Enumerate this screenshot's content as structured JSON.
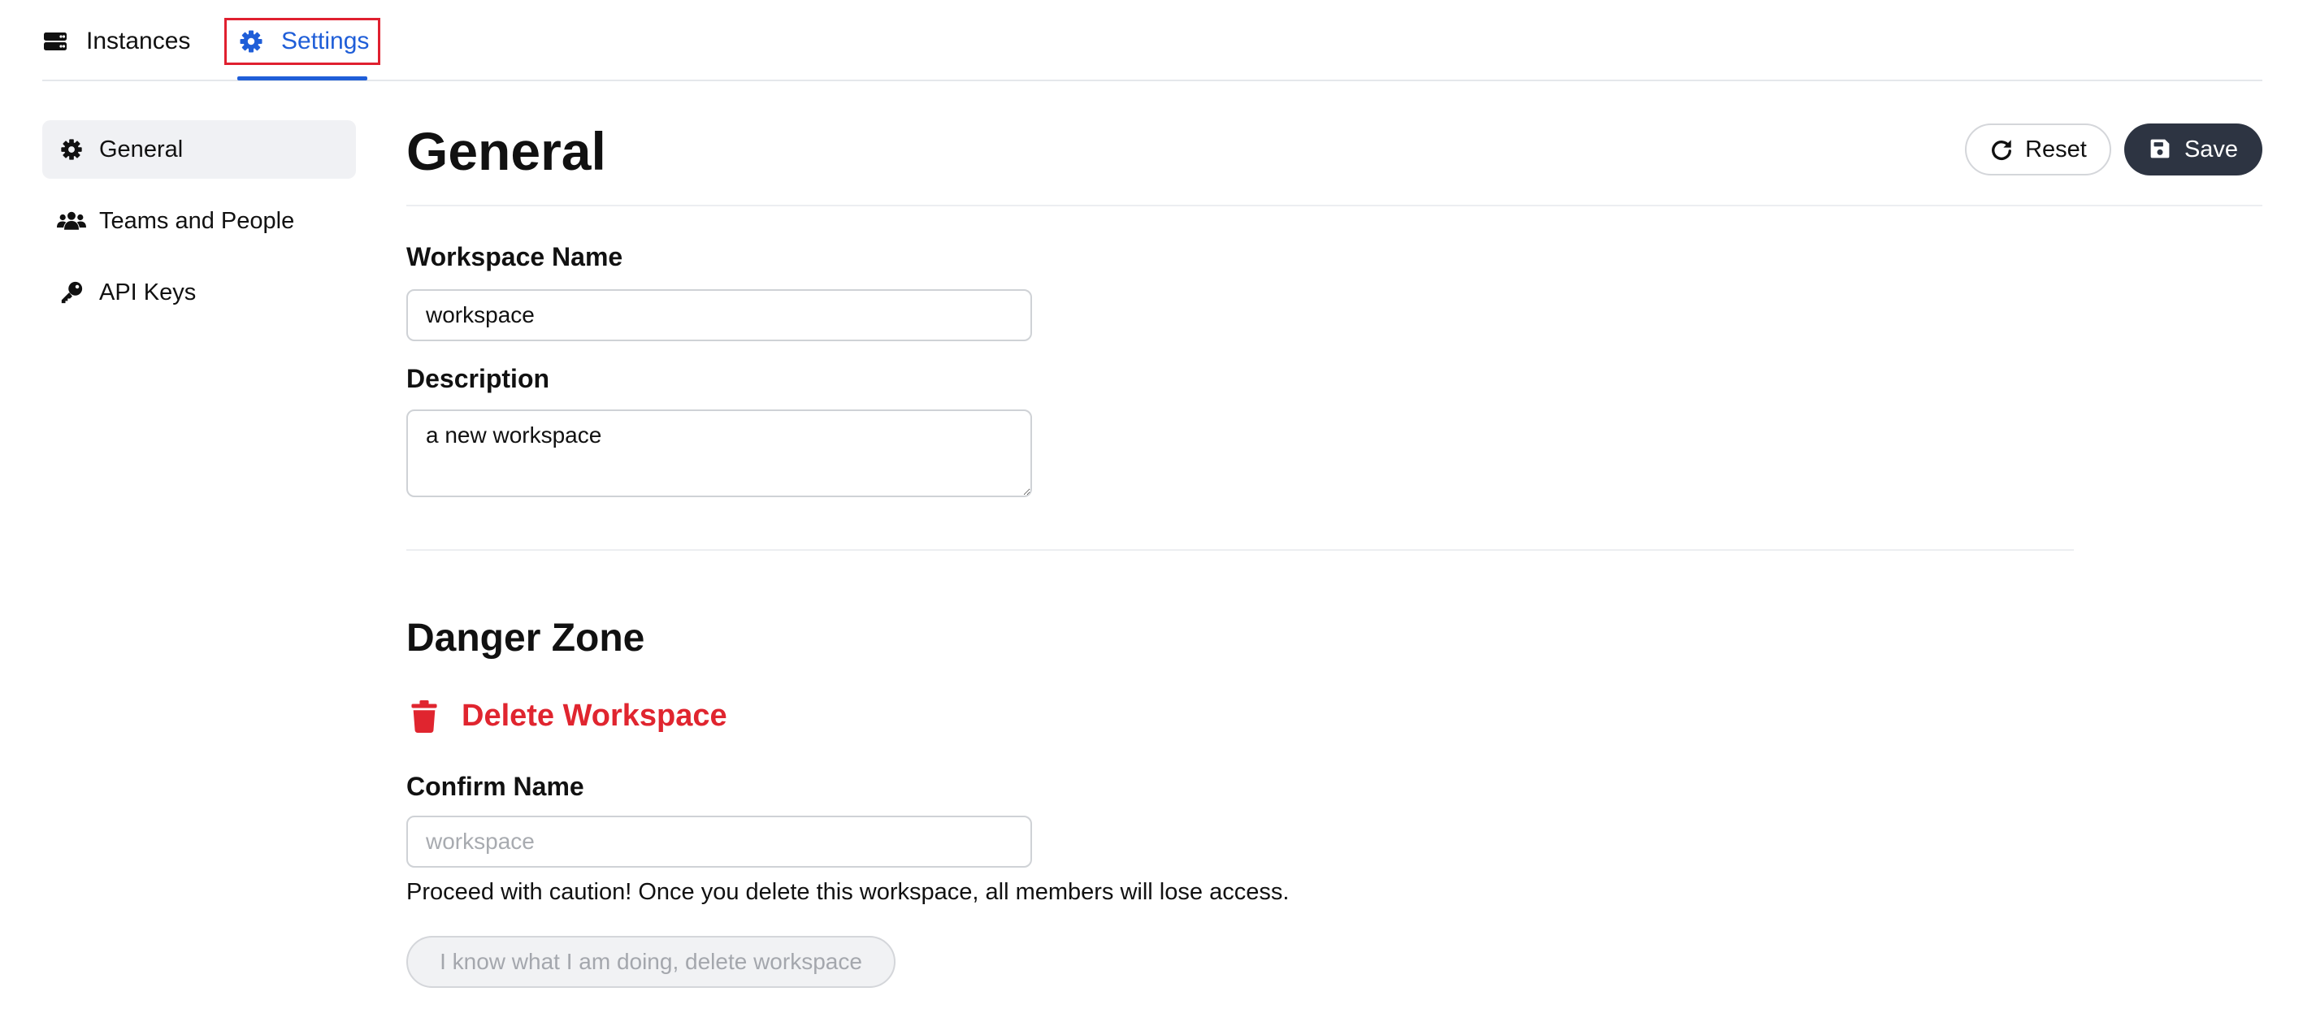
{
  "colors": {
    "accent": "#1f5ed8",
    "danger": "#e0252f",
    "primary_button": "#2d3442",
    "focus_outline": "#e0202f"
  },
  "top_tabs": [
    {
      "label": "Instances",
      "icon": "server-icon",
      "active": false
    },
    {
      "label": "Settings",
      "icon": "gear-icon",
      "active": true
    }
  ],
  "sidebar": {
    "items": [
      {
        "label": "General",
        "icon": "gear-icon",
        "active": true
      },
      {
        "label": "Teams and People",
        "icon": "users-icon",
        "active": false
      },
      {
        "label": "API Keys",
        "icon": "key-icon",
        "active": false
      }
    ]
  },
  "main": {
    "title": "General",
    "reset_label": "Reset",
    "save_label": "Save",
    "workspace_name": {
      "label": "Workspace Name",
      "value": "workspace"
    },
    "description": {
      "label": "Description",
      "value": "a new workspace"
    }
  },
  "danger_zone": {
    "title": "Danger Zone",
    "delete_label": "Delete Workspace",
    "confirm_label": "Confirm Name",
    "confirm_placeholder": "workspace",
    "confirm_value": "",
    "caution": "Proceed with caution! Once you delete this workspace, all members will lose access.",
    "confirm_button_label": "I know what I am doing, delete workspace"
  }
}
